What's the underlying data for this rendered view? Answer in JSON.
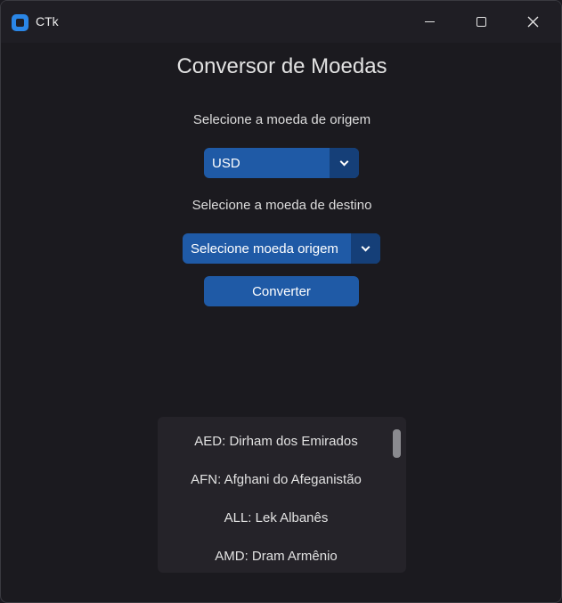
{
  "window": {
    "title": "CTk"
  },
  "main": {
    "heading": "Conversor de Moedas",
    "origin_label": "Selecione a moeda de origem",
    "origin_value": "USD",
    "dest_label": "Selecione a moeda de destino",
    "dest_value": "Selecione moeda origem",
    "convert_label": "Converter"
  },
  "currency_list": [
    "AED: Dirham dos Emirados",
    "AFN: Afghani do Afeganistão",
    "ALL: Lek Albanês",
    "AMD: Dram Armênio"
  ],
  "colors": {
    "accent": "#1f5aa6",
    "accent_dark": "#153f78",
    "background": "#1b1a1f",
    "list_background": "#252329"
  },
  "icons": [
    "app-icon",
    "minimize-icon",
    "maximize-icon",
    "close-icon",
    "chevron-down-icon"
  ]
}
